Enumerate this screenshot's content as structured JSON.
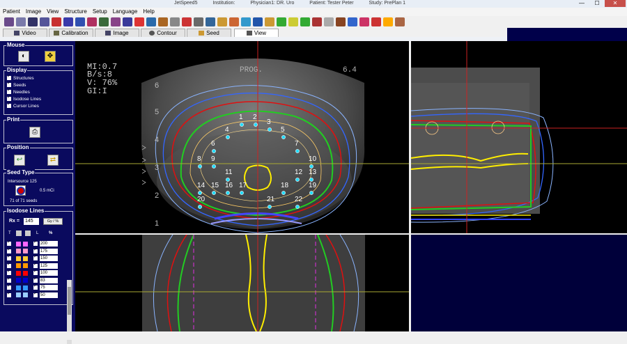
{
  "window": {
    "app": "JetSpeed5",
    "institution": "Institution:",
    "physician": "Physician1: DR. Uro",
    "patient": "Patient:  Tester Peter",
    "study": "Study: PrePlan 1",
    "min": "—",
    "max": "☐",
    "close": "✕"
  },
  "menu": [
    "Patient",
    "Image",
    "View",
    "Structure",
    "Setup",
    "Language",
    "Help"
  ],
  "tabs": {
    "video": "Video",
    "calibration": "Calibration",
    "image": "Image",
    "contour": "Contour",
    "seed": "Seed",
    "view": "View"
  },
  "sidebar": {
    "mouse": {
      "title": "Mouse"
    },
    "display": {
      "title": "Display",
      "items": [
        "Structures",
        "Seeds",
        "Needles",
        "Isodose Lines",
        "Cursor Lines"
      ]
    },
    "print": {
      "title": "Print"
    },
    "position": {
      "title": "Position"
    },
    "seedtype": {
      "title": "Seed Type",
      "name": "Intersource 125",
      "activity": "0.5 mCi",
      "count": "71 of 71 seeds"
    },
    "isodose": {
      "title": "Isodose Lines",
      "rx_label": "Rx =",
      "rx_value": "145",
      "unit_button": "Gy / %",
      "headers": {
        "t": "T",
        "l": "L",
        "pct": "%"
      },
      "levels": [
        "200",
        "175",
        "150",
        "125",
        "100",
        "83",
        "75",
        "50"
      ],
      "colors": [
        "#ff66ff",
        "#ff99cc",
        "#ffcc33",
        "#ff9900",
        "#ff0000",
        "#0000cc",
        "#3399ff",
        "#99ccff"
      ]
    }
  },
  "overlay": {
    "mi": "MI:0.7",
    "bs": "B/s:8",
    "v": "V:  76%",
    "gi": "GI:I",
    "prog": "PROG.",
    "depth": "6.4",
    "depth_marks": [
      "6",
      "5",
      "4",
      "3",
      "2",
      "1"
    ],
    "seeds": [
      "1",
      "2",
      "3",
      "4",
      "5",
      "6",
      "7",
      "8",
      "9",
      "10",
      "11",
      "12",
      "13",
      "14",
      "15",
      "16",
      "17",
      "18",
      "19",
      "20",
      "21",
      "22"
    ]
  },
  "colors": {
    "navy": "#0a0a5e",
    "accent_green": "#22cc22",
    "accent_yellow": "#ffee00",
    "red_line": "#e01010"
  }
}
